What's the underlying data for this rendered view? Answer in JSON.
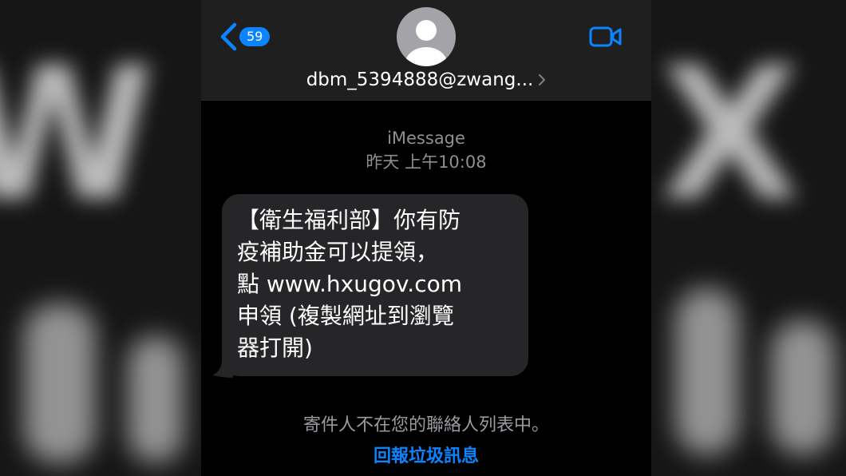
{
  "header": {
    "unread_count": "59",
    "contact": "dbm_5394888@zwang..."
  },
  "thread": {
    "service": "iMessage",
    "timestamp": "昨天 上午10:08",
    "message": "【衛生福利部】你有防\n疫補助金可以提領，\n點 www.hxugov.com\n申領 (複製網址到瀏覽\n器打開)"
  },
  "footer": {
    "notice": "寄件人不在您的聯絡人列表中。",
    "report_link": "回報垃圾訊息"
  },
  "colors": {
    "accent": "#0a84ff",
    "bubble": "#262629",
    "header_bg": "#1f1f1f",
    "secondary_text": "#8e8e93"
  },
  "icons": [
    "back-chevron-icon",
    "avatar-icon",
    "chevron-right-icon",
    "video-camera-icon"
  ]
}
